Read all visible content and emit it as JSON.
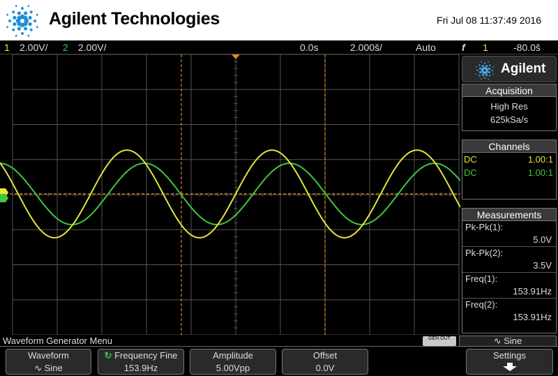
{
  "header": {
    "brand": "Agilent Technologies",
    "datetime": "Fri Jul 08 11:37:49 2016"
  },
  "statusbar": {
    "ch1_num": "1",
    "ch1_scale": "2.00V/",
    "ch2_num": "2",
    "ch2_scale": "2.00V/",
    "time_delay": "0.0s",
    "time_scale": "2.000š/",
    "trigger_mode": "Auto",
    "trigger_icon": "f",
    "trigger_source": "1",
    "trigger_level": "-80.0š"
  },
  "sidepanel": {
    "brand": "Agilent",
    "acquisition": {
      "title": "Acquisition",
      "mode": "High Res",
      "rate": "625kSa/s"
    },
    "channels": {
      "title": "Channels",
      "rows": [
        {
          "coupling": "DC",
          "ratio": "1.00:1"
        },
        {
          "coupling": "DC",
          "ratio": "1.00:1"
        }
      ]
    },
    "measurements": {
      "title": "Measurements",
      "items": [
        {
          "label": "Pk-Pk(1):",
          "value": "5.0V"
        },
        {
          "label": "Pk-Pk(2):",
          "value": "3.5V"
        },
        {
          "label": "Freq(1):",
          "value": "153.91Hz"
        },
        {
          "label": "Freq(2):",
          "value": "153.91Hz"
        }
      ]
    }
  },
  "scope": {
    "ch1_color": "#e6e63a",
    "ch2_color": "#3ec83e",
    "cursor_color": "#e08a1e",
    "grid_color": "#555555",
    "ch1_frequency_hz": 153.91,
    "ch2_frequency_hz": 153.91,
    "ch1_pkpk_v": 5.0,
    "ch2_pkpk_v": 3.5
  },
  "bottom": {
    "menu_title": "Waveform Generator Menu",
    "gen_out": "GEN OUT",
    "sine_label": "Sine",
    "softkeys": [
      {
        "top": "Waveform",
        "bottom": "Sine"
      },
      {
        "top": "Frequency Fine",
        "bottom": "153.9Hz"
      },
      {
        "top": "Amplitude",
        "bottom": "5.00Vpp"
      },
      {
        "top": "Offset",
        "bottom": "0.0V"
      },
      {
        "top": "Settings",
        "bottom": ""
      }
    ]
  }
}
